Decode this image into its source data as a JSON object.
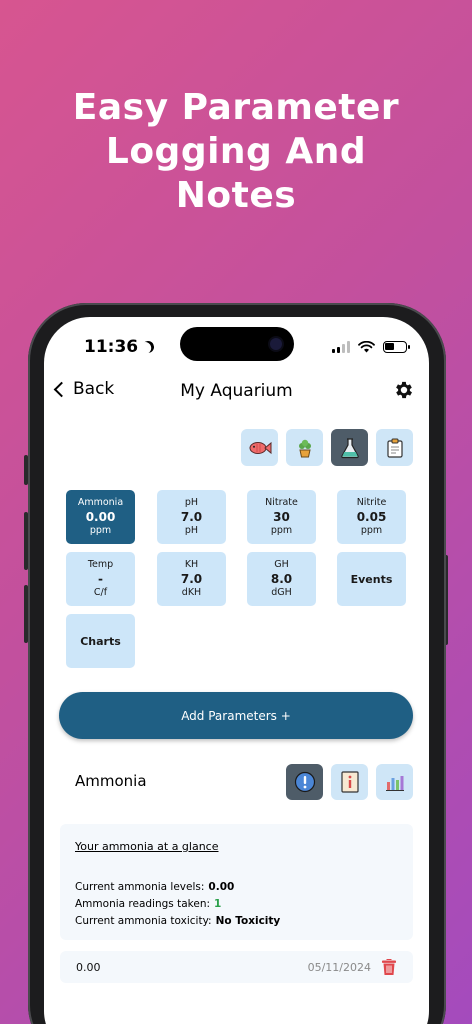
{
  "headline": "Easy Parameter\nLogging And\nNotes",
  "status_bar": {
    "time": "11:36"
  },
  "nav": {
    "back_label": "Back",
    "title": "My Aquarium"
  },
  "top_tabs": [
    {
      "icon": "fish-icon"
    },
    {
      "icon": "plant-icon"
    },
    {
      "icon": "flask-icon",
      "active": true
    },
    {
      "icon": "clipboard-icon"
    }
  ],
  "tiles": {
    "ammonia": {
      "label": "Ammonia",
      "value": "0.00",
      "unit": "ppm"
    },
    "ph": {
      "label": "pH",
      "value": "7.0",
      "unit": "pH"
    },
    "nitrate": {
      "label": "Nitrate",
      "value": "30",
      "unit": "ppm"
    },
    "nitrite": {
      "label": "Nitrite",
      "value": "0.05",
      "unit": "ppm"
    },
    "temp": {
      "label": "Temp",
      "value": "-",
      "unit": "C/f"
    },
    "kh": {
      "label": "KH",
      "value": "7.0",
      "unit": "dKH"
    },
    "gh": {
      "label": "GH",
      "value": "8.0",
      "unit": "dGH"
    },
    "events": {
      "label": "Events"
    },
    "charts": {
      "label": "Charts"
    }
  },
  "add_button": {
    "label": "Add Parameters +"
  },
  "section": {
    "title": "Ammonia"
  },
  "glance": {
    "title": "Your ammonia at a glance",
    "levels_label": "Current ammonia levels:",
    "levels_value": "0.00",
    "readings_label": "Ammonia readings taken:",
    "readings_value": "1",
    "toxicity_label": "Current ammonia toxicity:",
    "toxicity_value": "No Toxicity"
  },
  "entries": [
    {
      "value": "0.00",
      "date": "05/11/2024"
    }
  ],
  "colors": {
    "accent": "#1f5f84",
    "tile": "#cde6f9",
    "active_tab": "#4e5c68",
    "green": "#2aa04a",
    "delete": "#e0474c"
  }
}
